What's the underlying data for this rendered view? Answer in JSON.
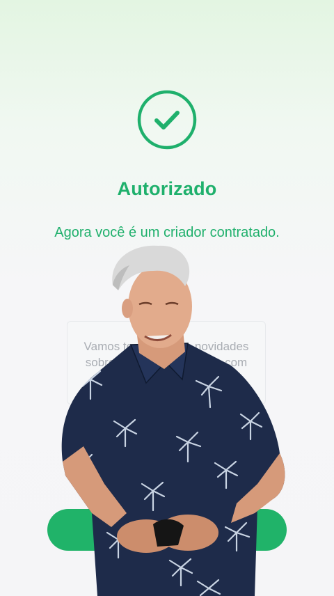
{
  "app": {
    "background_colors": [
      "#e3f5e2",
      "#f5f5f7"
    ],
    "accent_color": "#1fb06c"
  },
  "status": {
    "icon": "check-circle-icon",
    "title": "Autorizado",
    "subtitle": "Agora você é um criador contratado."
  },
  "info_card": {
    "text": "Vamos te ajudar nas novidades sobre… para ajudar no … com"
  },
  "primary_action": {
    "label": ""
  },
  "overlay": {
    "type": "video-presenter",
    "shirt_color": "#1e2b4a",
    "pattern_color": "#c9d4e3"
  }
}
